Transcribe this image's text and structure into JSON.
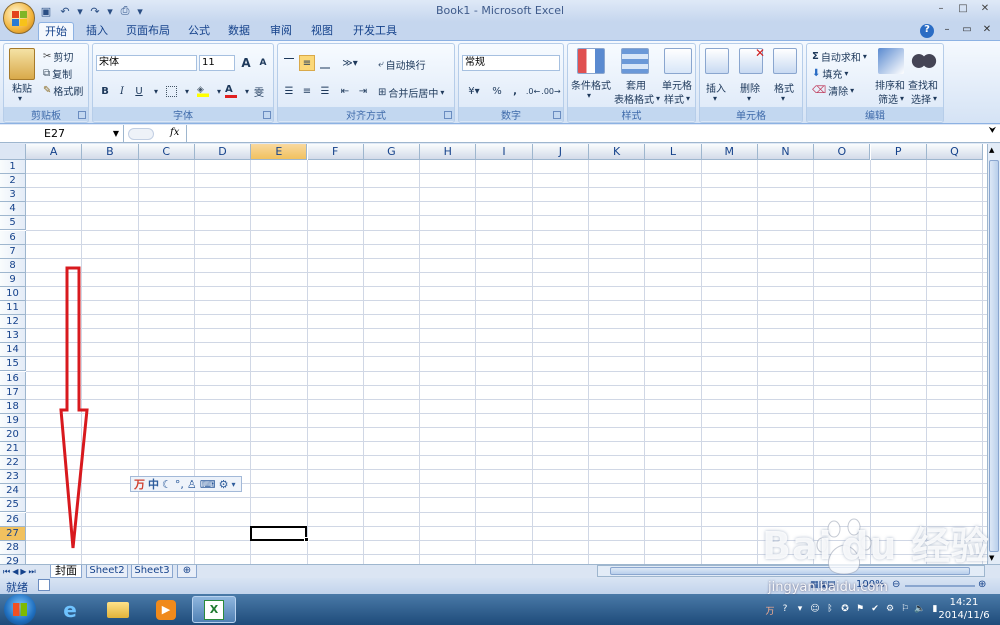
{
  "window": {
    "title": "Book1 - Microsoft Excel",
    "minimize_label": "–",
    "maximize_label": "□",
    "close_label": "✕"
  },
  "qat": [
    "save-icon",
    "undo-icon",
    "redo-icon",
    "print-preview-icon"
  ],
  "tabs": [
    "开始",
    "插入",
    "页面布局",
    "公式",
    "数据",
    "审阅",
    "视图",
    "开发工具"
  ],
  "active_tab": "开始",
  "ribbon": {
    "clipboard": {
      "label": "剪贴板",
      "paste": "粘贴",
      "cut": "剪切",
      "copy": "复制",
      "format_painter": "格式刷"
    },
    "font": {
      "label": "字体",
      "font_name": "宋体",
      "font_size": "11",
      "bold": "B",
      "italic": "I",
      "underline": "U",
      "grow": "A",
      "shrink": "A"
    },
    "alignment": {
      "label": "对齐方式",
      "wrap": "自动换行",
      "merge": "合并后居中"
    },
    "number": {
      "label": "数字",
      "format": "常规",
      "percent": "%",
      "comma": ","
    },
    "styles": {
      "label": "样式",
      "conditional_1": "条件格式",
      "table_1": "套用",
      "table_2": "表格格式",
      "cell_1": "单元格",
      "cell_2": "样式"
    },
    "cells": {
      "label": "单元格",
      "insert": "插入",
      "delete": "删除",
      "format": "格式"
    },
    "editing": {
      "label": "编辑",
      "autosum": "自动求和",
      "fill": "填充",
      "clear": "清除",
      "sort_1": "排序和",
      "sort_2": "筛选",
      "find_1": "查找和",
      "find_2": "选择"
    }
  },
  "formula_bar": {
    "name_box": "E27",
    "fx": "fx",
    "formula": ""
  },
  "columns": [
    "A",
    "B",
    "C",
    "D",
    "E",
    "F",
    "G",
    "H",
    "I",
    "J",
    "K",
    "L",
    "M",
    "N",
    "O",
    "P",
    "Q"
  ],
  "rows": [
    "1",
    "2",
    "3",
    "4",
    "5",
    "6",
    "7",
    "8",
    "9",
    "10",
    "11",
    "12",
    "13",
    "14",
    "15",
    "16",
    "17",
    "18",
    "19",
    "20",
    "21",
    "22",
    "23",
    "24",
    "25",
    "26",
    "27",
    "28",
    "29"
  ],
  "selected_cell": "E27",
  "ime_toolbar": {
    "mode": "中",
    "punct": "°,"
  },
  "sheets": [
    "封面",
    "Sheet2",
    "Sheet3"
  ],
  "active_sheet": "封面",
  "status": {
    "ready": "就绪",
    "zoom": "100%"
  },
  "taskbar": {
    "time": "14:21",
    "date": "2014/11/6"
  },
  "watermark": {
    "text": "Bai du 经验",
    "url": "jingyan.baidu.com"
  },
  "annotation_color": "#d8191e"
}
